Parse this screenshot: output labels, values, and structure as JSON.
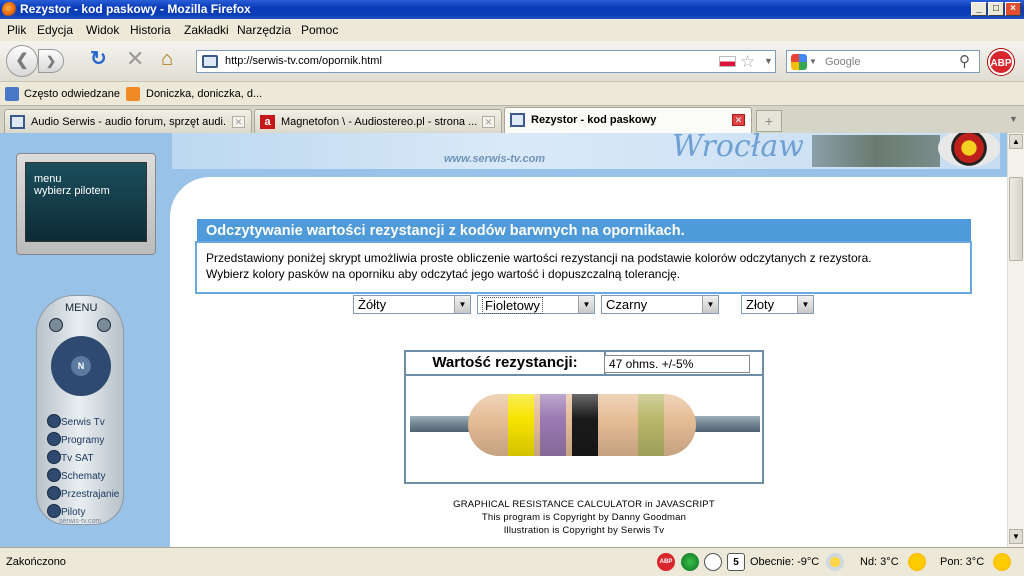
{
  "window": {
    "title": "Rezystor - kod paskowy - Mozilla Firefox",
    "controls": [
      "_",
      "□",
      "×"
    ]
  },
  "menu": [
    "Plik",
    "Edycja",
    "Widok",
    "Historia",
    "Zakładki",
    "Narzędzia",
    "Pomoc"
  ],
  "nav": {
    "url": "http://serwis-tv.com/opornik.html",
    "search_placeholder": "Google"
  },
  "bookmarks": [
    "Często odwiedzane",
    "Doniczka, doniczka, d..."
  ],
  "tabs": [
    {
      "label": "Audio Serwis - audio forum, sprzęt audi...",
      "active": false
    },
    {
      "label": "Magnetofon \\ - Audiostereo.pl - strona ...",
      "active": false
    },
    {
      "label": "Rezystor - kod paskowy",
      "active": true
    }
  ],
  "page": {
    "banner_title": "Wrocław",
    "banner_site": "www.serwis-tv.com",
    "tv_lines": [
      "menu",
      "wybierz pilotem"
    ],
    "remote": {
      "title": "MENU",
      "items": [
        "Serwis Tv",
        "Programy",
        "Tv SAT",
        "Schematy",
        "Przestrajanie",
        "Piloty"
      ],
      "footer": "serwis-tv.com"
    },
    "heading": "Odczytywanie wartości rezystancji z kodów barwnych na opornikach.",
    "description": [
      "Przedstawiony poniżej skrypt umożliwia proste obliczenie wartości rezystancji na podstawie kolorów odczytanych z rezystora.",
      "Wybierz kolory pasków na oporniku aby odczytać jego wartość i dopuszczalną tolerancję."
    ],
    "selects": [
      "Żółty",
      "Fioletowy",
      "Czarny",
      "Złoty"
    ],
    "result_label": "Wartość rezystancji:",
    "result_value": "47 ohms. +/-5%",
    "band_colors": [
      "#f7e400",
      "#9b7ab3",
      "#1a1a1a",
      "#b9b86a"
    ],
    "body_color": "#e6bd96",
    "credits": [
      "GRAPHICAL RESISTANCE CALCULATOR in JAVASCRIPT",
      "This program is Copyright by Danny Goodman",
      "Illustration is Copyright by Serwis Tv"
    ]
  },
  "status": {
    "text": "Zakończono",
    "weather_now": "Obecnie: -9°C",
    "weather_sun": "Nd: 3°C",
    "weather_mon": "Pon: 3°C",
    "calendar_day": "5"
  }
}
